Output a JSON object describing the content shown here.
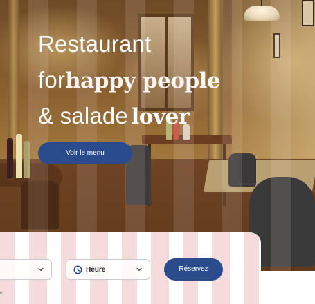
{
  "hero": {
    "line1": "Restaurant",
    "line2_light": "for",
    "line2_bold": "happy people",
    "line3_light": "& salade",
    "line3_bold": "lover",
    "menu_button": "Voir le menu"
  },
  "booking": {
    "date_select": {
      "value": "",
      "icon": "chevron-down-icon"
    },
    "hour_select": {
      "value": "Heure",
      "icon": "clock-icon"
    },
    "reserve_button": "Réservez"
  },
  "colors": {
    "accent": "#2b4c8c",
    "stripe_pink": "#f4dcdd",
    "text_light": "#ffffff"
  }
}
